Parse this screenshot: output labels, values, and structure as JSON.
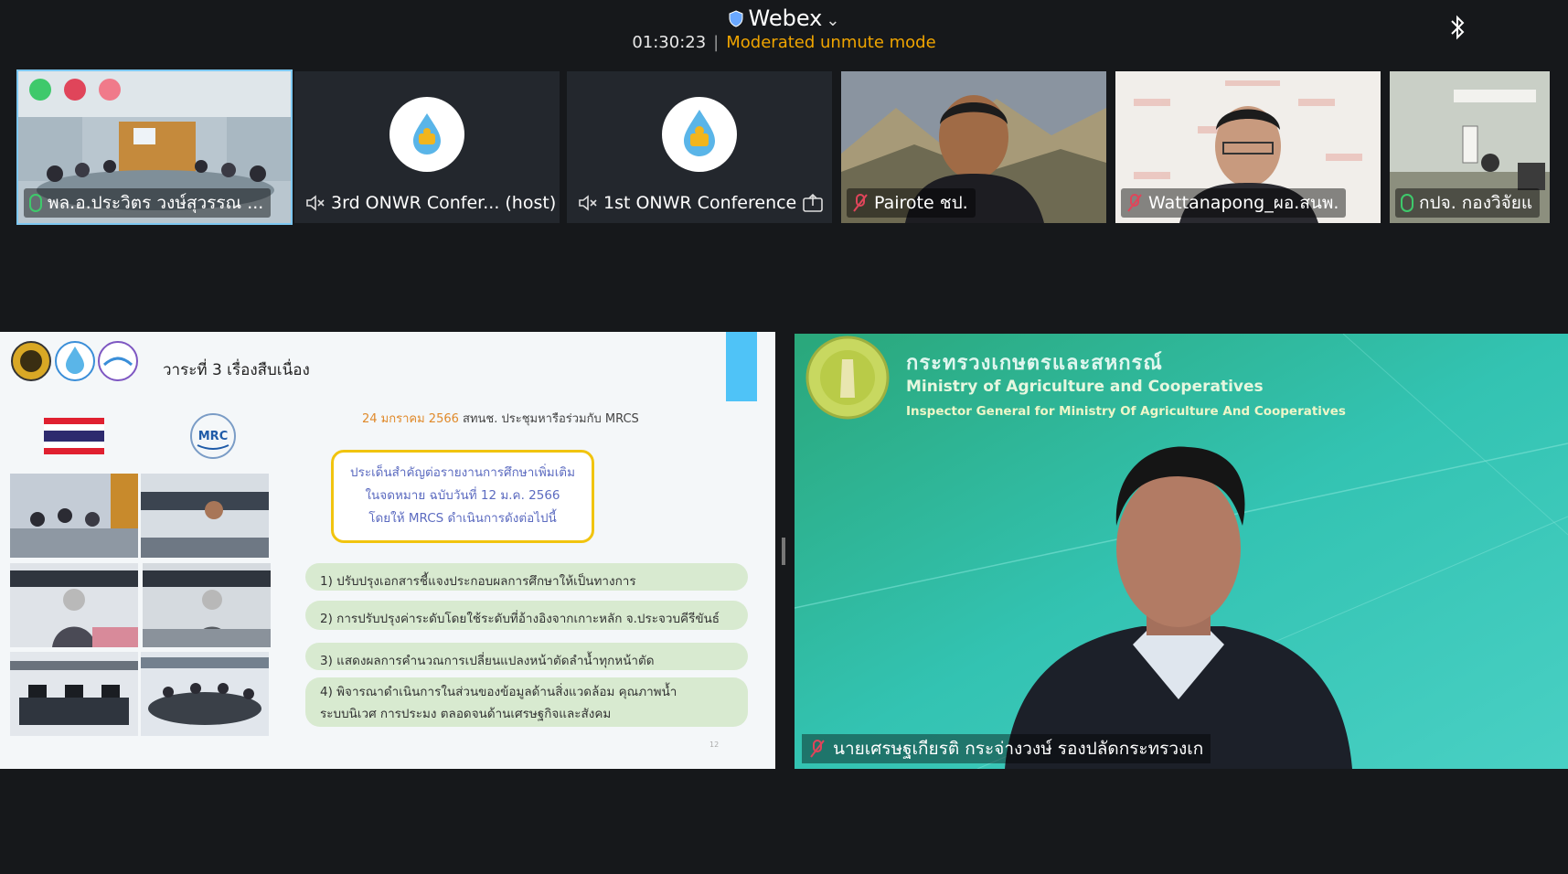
{
  "header": {
    "app_name": "Webex",
    "timer": "01:30:23",
    "separator": "|",
    "mode": "Moderated unmute mode"
  },
  "participants": [
    {
      "name": "พล.อ.ประวิตร วงษ์สุวรรณ ...",
      "mic": "on",
      "active": true
    },
    {
      "name": "3rd ONWR Confer... (host)",
      "mic": "speaker-muted"
    },
    {
      "name": "1st ONWR Conference",
      "mic": "speaker-muted",
      "sharing": true
    },
    {
      "name": "Pairote ชป.",
      "mic": "muted"
    },
    {
      "name": "Wattanapong_ผอ.สนพ.",
      "mic": "muted"
    },
    {
      "name": "กปจ. กองวิจัยแ",
      "mic": "on"
    }
  ],
  "slide": {
    "agenda": "วาระที่ 3 เรื่องสืบเนื่อง",
    "logo_text": "MRC",
    "date_hdr_date": "24 มกราคม 2566",
    "date_hdr_rest": " สทนช. ประชุมหารือร่วมกับ MRCS",
    "box_lines": [
      "ประเด็นสำคัญต่อรายงานการศึกษาเพิ่มเติม",
      "ในจดหมาย ฉบับวันที่ 12 ม.ค. 2566",
      "โดยให้ MRCS ดำเนินการดังต่อไปนี้"
    ],
    "items": [
      "1) ปรับปรุงเอกสารชี้แจงประกอบผลการศึกษาให้เป็นทางการ",
      "2) การปรับปรุงค่าระดับโดยใช้ระดับที่อ้างอิงจากเกาะหลัก จ.ประจวบคีรีขันธ์",
      "3) แสดงผลการคำนวณการเปลี่ยนแปลงหน้าตัดลำน้ำทุกหน้าตัด",
      "4) พิจารณาดำเนินการในส่วนของข้อมูลด้านสิ่งแวดล้อม คุณภาพน้ำ",
      "ระบบนิเวศ การประมง ตลอดจนด้านเศรษฐกิจและสังคม"
    ],
    "page": "12"
  },
  "speaker": {
    "org_th": "กระทรวงเกษตรและสหกรณ์",
    "org_en": "Ministry of Agriculture and Cooperatives",
    "org_sub": "Inspector General for Ministry Of Agriculture And Cooperatives",
    "name": "นายเศรษฐเกียรติ กระจ่างวงษ์ รองปลัดกระทรวงเก"
  },
  "colors": {
    "accent_orange": "#f0a500",
    "active_outline": "#7ec8f2",
    "mic_on": "#3ec96b",
    "mic_off": "#e0455a",
    "slide_blue_tab": "#4fc3f7",
    "slide_box_border": "#f1c40f",
    "slide_item_bg": "#d8ead0",
    "speaker_bg": "#2db7a4"
  }
}
